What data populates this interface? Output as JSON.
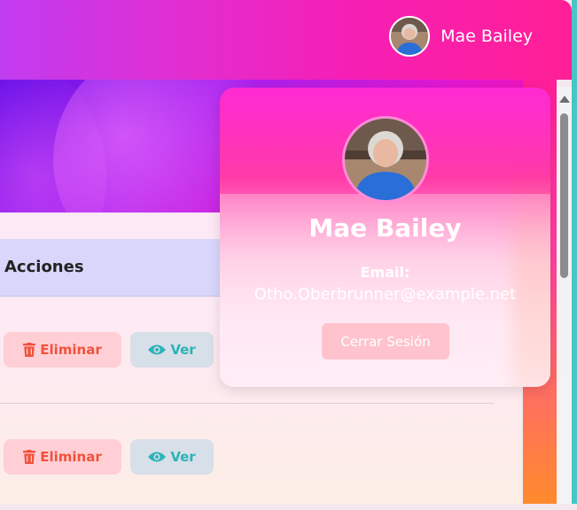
{
  "header": {
    "user_name": "Mae Bailey",
    "avatar": "user-avatar"
  },
  "table": {
    "header_actions": "Acciones",
    "rows": [
      {
        "delete_label": "Eliminar",
        "delete_icon": "trash-icon",
        "view_label": "Ver",
        "view_icon": "eye-icon"
      },
      {
        "delete_label": "Eliminar",
        "delete_icon": "trash-icon",
        "view_label": "Ver",
        "view_icon": "eye-icon"
      }
    ]
  },
  "profile_popup": {
    "name": "Mae Bailey",
    "email_label": "Email:",
    "email": "Otho.Oberbrunner@example.net",
    "logout_label": "Cerrar Sesión"
  },
  "colors": {
    "header_gradient_start": "#c03cf0",
    "header_gradient_end": "#ff1f96",
    "delete_text": "#f0523c",
    "delete_bg": "#ffcfd5",
    "view_text": "#2bb3b8",
    "view_bg": "#d7dfe8",
    "table_header_bg": "#d8d6fb"
  }
}
